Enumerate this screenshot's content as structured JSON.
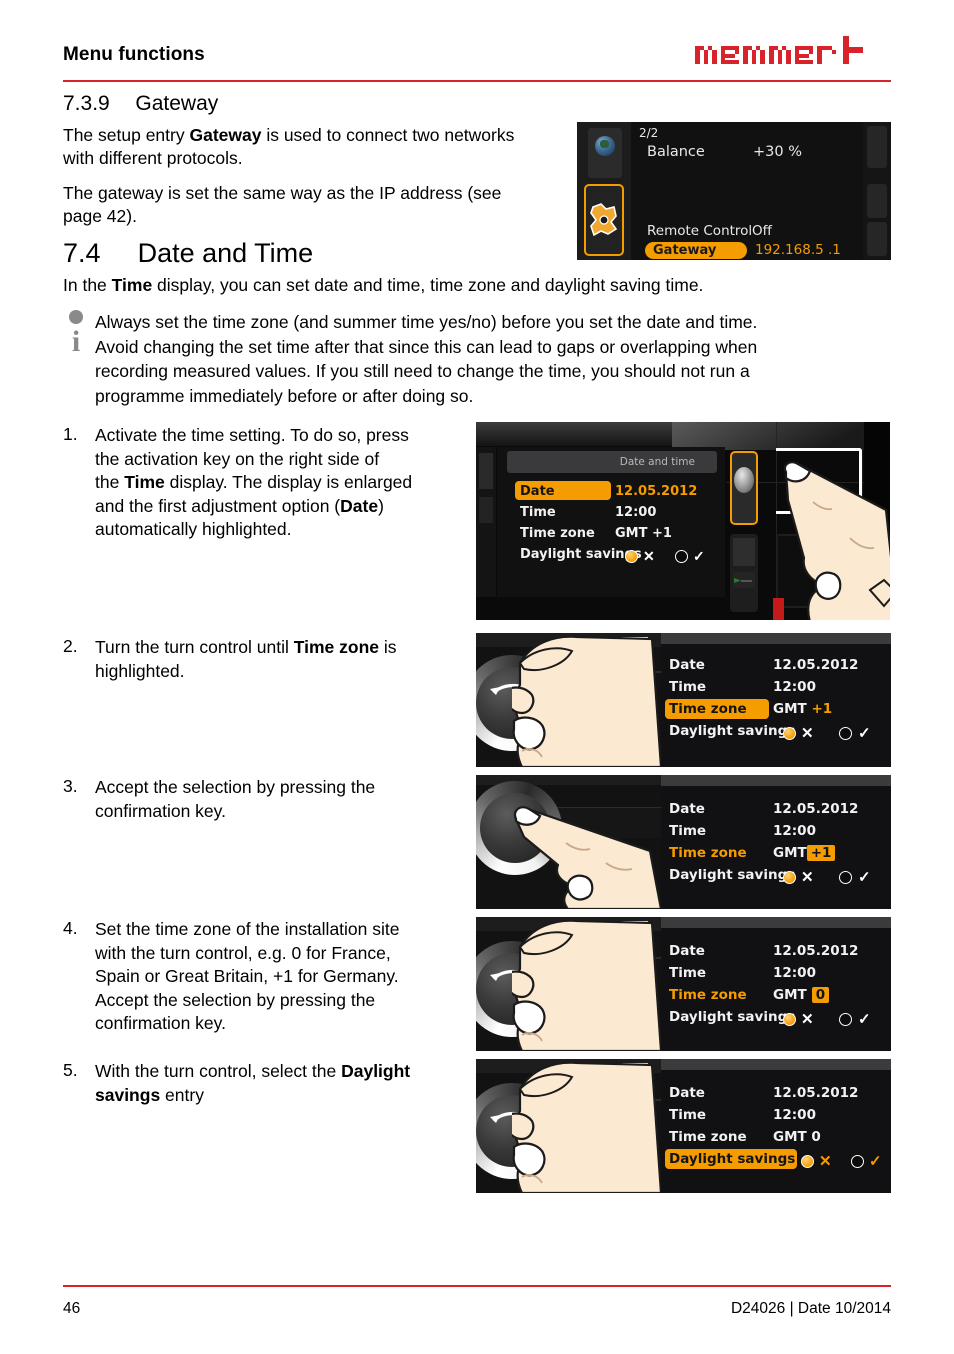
{
  "header": {
    "title": "Menu functions",
    "logo_text": "memmert",
    "brand_red": "#d8232a"
  },
  "accent": {
    "orange": "#f59c00",
    "screen_bg": "#111113"
  },
  "section_739": {
    "number": "7.3.9",
    "title": "Gateway",
    "para1_a": "The setup entry ",
    "para1_b": "Gateway",
    "para1_c": " is used to connect two networks",
    "para1_d": "with different protocols.",
    "para2_a": "The gateway is set the same way as the IP address (see",
    "para2_b": "page 42)."
  },
  "gateway_screen": {
    "page_indicator": "2/2",
    "balance_label": "Balance",
    "balance_value": "+30 %",
    "remote_label": "Remote Control",
    "remote_value": "Off",
    "gateway_label": "Gateway",
    "gateway_value": "192.168.5 .1",
    "icon_globe": "globe-icon",
    "icon_gear": "gear-icon"
  },
  "section_74": {
    "number": "7.4",
    "title": "Date and Time",
    "intro_a": "In the ",
    "intro_b": "Time",
    "intro_c": " display, you can set date and time, time zone and daylight saving time."
  },
  "note": {
    "icon": "info-icon",
    "line1": "Always set the time zone (and summer time yes/no) before you set the date and time.",
    "line2": "Avoid changing the set time after that since this can lead to gaps or overlapping when",
    "line3": "recording measured values. If you still need to change the time, you should not run a",
    "line4": "programme immediately before or after doing so."
  },
  "steps": [
    {
      "num": "1.",
      "lines": [
        {
          "a": "Activate the time setting. To do so, press"
        },
        {
          "a": "the activation key on the right side of"
        },
        {
          "a": "the ",
          "b": "Time",
          "c": " display. The display is enlarged"
        },
        {
          "a": "and the first adjustment option (",
          "b": "Date",
          "c": ")"
        },
        {
          "a": "automatically highlighted."
        }
      ]
    },
    {
      "num": "2.",
      "lines": [
        {
          "a": "Turn the turn control until ",
          "b": "Time zone",
          "c": " is"
        },
        {
          "a": "highlighted."
        }
      ]
    },
    {
      "num": "3.",
      "lines": [
        {
          "a": "Accept the selection by pressing the"
        },
        {
          "a": "confirmation key."
        }
      ]
    },
    {
      "num": "4.",
      "lines": [
        {
          "a": "Set the time zone of the installation site"
        },
        {
          "a": "with the turn control, e.g. 0 for France,"
        },
        {
          "a": "Spain or Great Britain, +1 for Germany."
        },
        {
          "a": "Accept the selection by pressing the"
        },
        {
          "a": "confirmation key."
        }
      ]
    },
    {
      "num": "5.",
      "lines": [
        {
          "a": "With the turn control, select the ",
          "b": "Daylight"
        },
        {
          "a": "",
          "b": "savings",
          "c": " entry"
        }
      ]
    }
  ],
  "display_step1": {
    "title": "Date and time",
    "date_label": "Date",
    "date_value": "12.05.2012",
    "time_label": "Time",
    "time_value": "12:00",
    "zone_label": "Time zone",
    "zone_value": "GMT +1",
    "dls_label": "Daylight savings",
    "dls_x": "✕",
    "dls_check": "✓"
  },
  "display_step2": {
    "date_label": "Date",
    "date_value": "12.05.2012",
    "time_label": "Time",
    "time_value": "12:00",
    "zone_label": "Time zone",
    "zone_gmt": "GMT ",
    "zone_offset": "+1",
    "dls_label": "Daylight savings",
    "dls_x": "✕",
    "dls_check": "✓"
  },
  "display_step3": {
    "date_label": "Date",
    "date_value": "12.05.2012",
    "time_label": "Time",
    "time_value": "12:00",
    "zone_label": "Time zone",
    "zone_gmt": "GMT",
    "zone_offset": "+1",
    "dls_label": "Daylight savings",
    "dls_x": "✕",
    "dls_check": "✓"
  },
  "display_step4": {
    "date_label": "Date",
    "date_value": "12.05.2012",
    "time_label": "Time",
    "time_value": "12:00",
    "zone_label": "Time zone",
    "zone_gmt": "GMT",
    "zone_offset": "0",
    "dls_label": "Daylight savings",
    "dls_x": "✕",
    "dls_check": "✓"
  },
  "display_step5": {
    "date_label": "Date",
    "date_value": "12.05.2012",
    "time_label": "Time",
    "time_value": "12:00",
    "zone_label": "Time zone",
    "zone_value": "GMT 0",
    "dls_label": "Daylight savings",
    "dls_x": "✕",
    "dls_check": "✓"
  },
  "footer": {
    "page": "46",
    "doc": "D24026 | Date 10/2014"
  }
}
